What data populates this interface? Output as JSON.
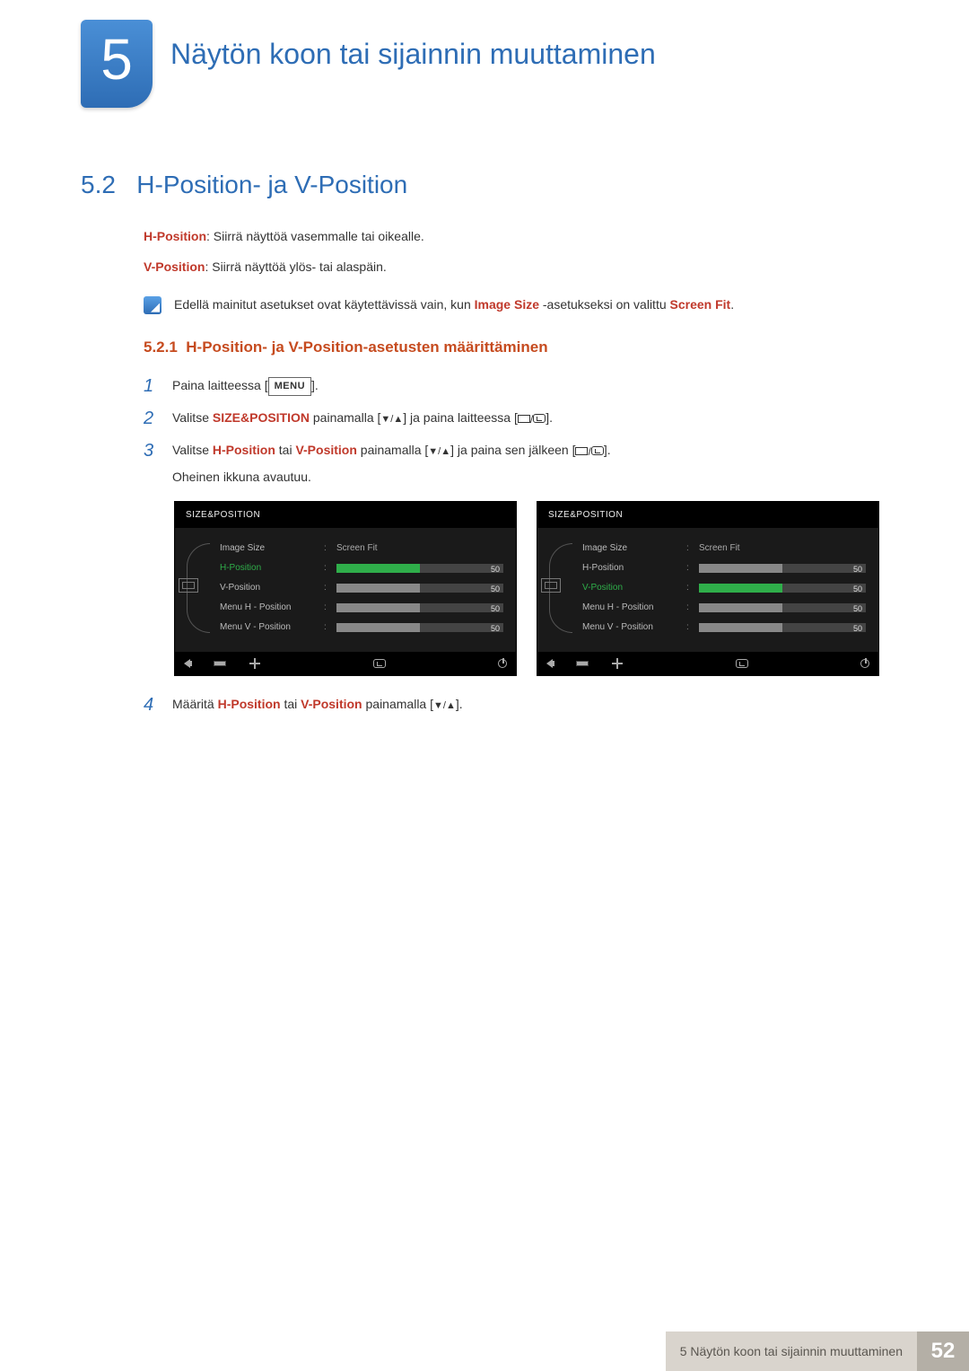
{
  "chapter": {
    "number": "5",
    "title": "Näytön koon tai sijainnin muuttaminen"
  },
  "section": {
    "number": "5.2",
    "title": "H-Position- ja V-Position"
  },
  "definitions": {
    "hpos_label": "H-Position",
    "hpos_text": ": Siirrä näyttöä vasemmalle tai oikealle.",
    "vpos_label": "V-Position",
    "vpos_text": ": Siirrä näyttöä ylös- tai alaspäin."
  },
  "note": {
    "pre": "Edellä mainitut asetukset ovat käytettävissä vain, kun ",
    "term1": "Image Size",
    "mid": " -asetukseksi on valittu ",
    "term2": "Screen Fit",
    "post": "."
  },
  "subsection": {
    "number": "5.2.1",
    "title": "H-Position- ja V-Position-asetusten määrittäminen"
  },
  "steps": {
    "s1": {
      "num": "1",
      "pre": "Paina laitteessa [",
      "menu": "MENU",
      "post": "]."
    },
    "s2": {
      "num": "2",
      "pre": "Valitse ",
      "hl": "SIZE&POSITION",
      "mid": " painamalla [",
      "mid2": "] ja paina laitteessa [",
      "post": "]."
    },
    "s3": {
      "num": "3",
      "pre": "Valitse ",
      "hl1": "H-Position",
      "or": " tai ",
      "hl2": "V-Position",
      "mid": " painamalla [",
      "mid2": "] ja paina sen jälkeen [",
      "post": "].",
      "line2": "Oheinen ikkuna avautuu."
    },
    "s4": {
      "num": "4",
      "pre": "Määritä ",
      "hl1": "H-Position",
      "or": " tai ",
      "hl2": "V-Position",
      "mid": " painamalla [",
      "post": "]."
    }
  },
  "osd": {
    "title": "SIZE&POSITION",
    "items": [
      {
        "label": "Image Size",
        "value_text": "Screen Fit"
      },
      {
        "label": "H-Position",
        "value_num": "50"
      },
      {
        "label": "V-Position",
        "value_num": "50"
      },
      {
        "label": "Menu H - Position",
        "value_num": "50"
      },
      {
        "label": "Menu V - Position",
        "value_num": "50"
      }
    ],
    "selected_left": 1,
    "selected_right": 2
  },
  "footer": {
    "text": "5 Näytön koon tai sijainnin muuttaminen",
    "page": "52"
  }
}
